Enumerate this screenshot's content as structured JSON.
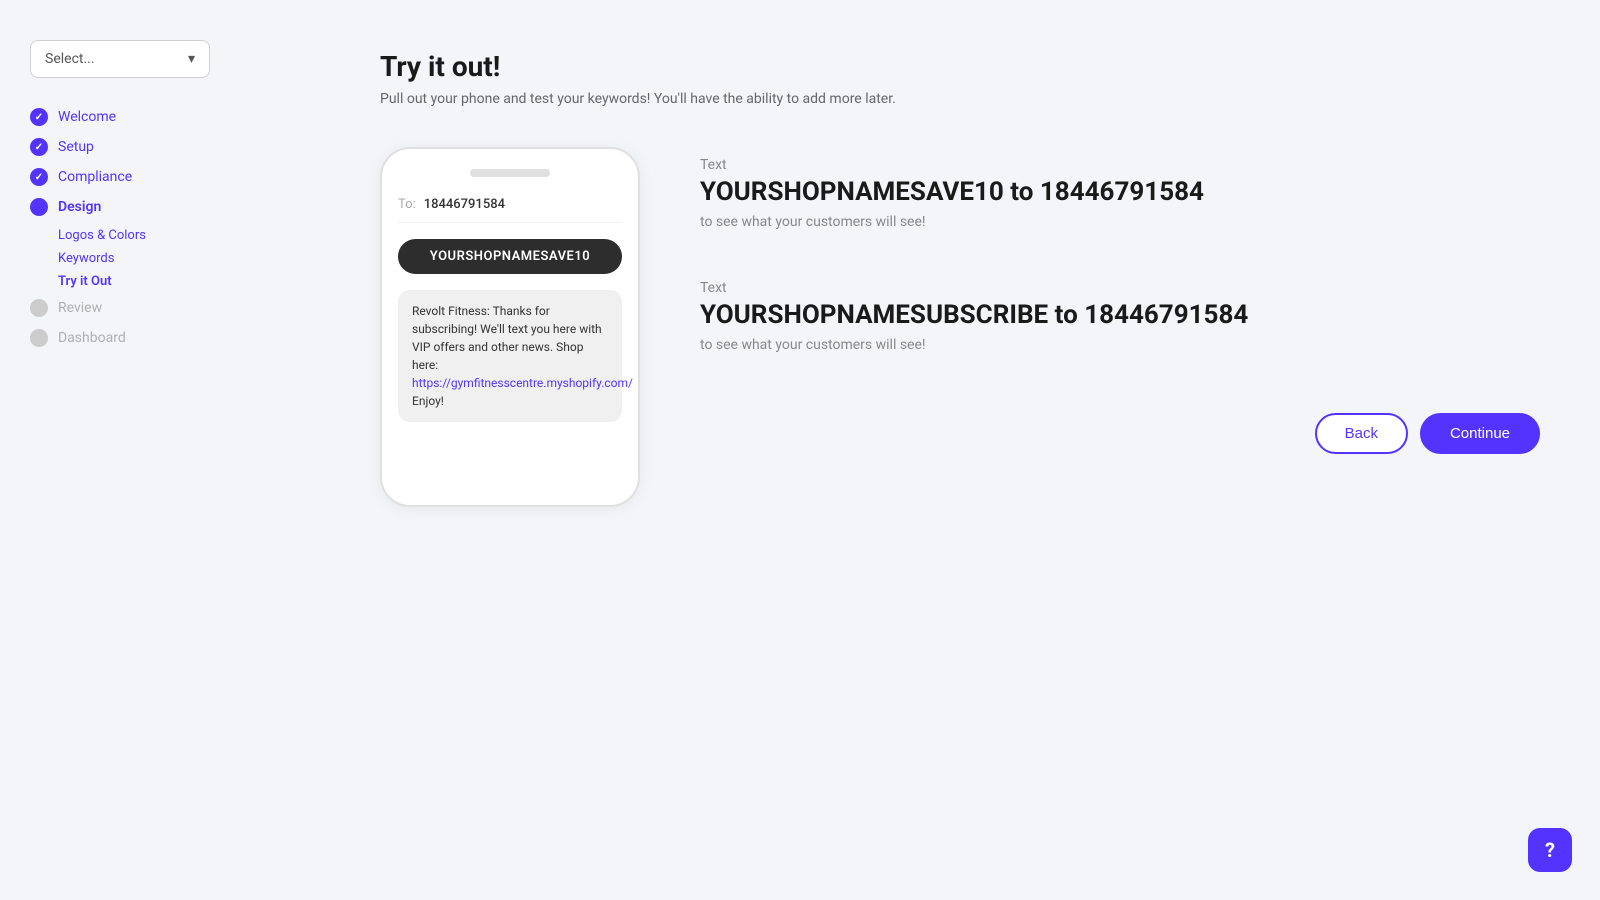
{
  "sidebar": {
    "select_placeholder": "Select...",
    "nav_items": [
      {
        "id": "welcome",
        "label": "Welcome",
        "state": "completed"
      },
      {
        "id": "setup",
        "label": "Setup",
        "state": "completed"
      },
      {
        "id": "compliance",
        "label": "Compliance",
        "state": "completed"
      },
      {
        "id": "design",
        "label": "Design",
        "state": "active",
        "sub_items": [
          {
            "id": "logos-colors",
            "label": "Logos & Colors",
            "state": "normal"
          },
          {
            "id": "keywords",
            "label": "Keywords",
            "state": "normal"
          },
          {
            "id": "try-it-out",
            "label": "Try it Out",
            "state": "active"
          }
        ]
      },
      {
        "id": "review",
        "label": "Review",
        "state": "inactive"
      },
      {
        "id": "dashboard",
        "label": "Dashboard",
        "state": "inactive"
      }
    ]
  },
  "main": {
    "title": "Try it out!",
    "subtitle": "Pull out your phone and test your keywords! You'll have the ability to add more later.",
    "phone": {
      "to_label": "To:",
      "phone_number": "18446791584",
      "keyword_bubble": "YOURSHOPNAMESAVE10",
      "reply_text": "Revolt Fitness: Thanks for subscribing! We'll text you here with VIP offers and other news. Shop here: https://gymfitnesscentre.myshopify.com/ Enjoy!",
      "reply_link": "https://gymfitnesscentre.myshopify.com/"
    },
    "instructions": [
      {
        "label": "Text",
        "main": "YOURSHOPNAMESAVE10 to 18446791584",
        "sub": "to see what your customers will see!"
      },
      {
        "label": "Text",
        "main": "YOURSHOPNAMESUBSCRIBE to 18446791584",
        "sub": "to see what your customers will see!"
      }
    ],
    "buttons": {
      "back": "Back",
      "continue": "Continue"
    }
  },
  "help": {
    "icon": "?"
  }
}
